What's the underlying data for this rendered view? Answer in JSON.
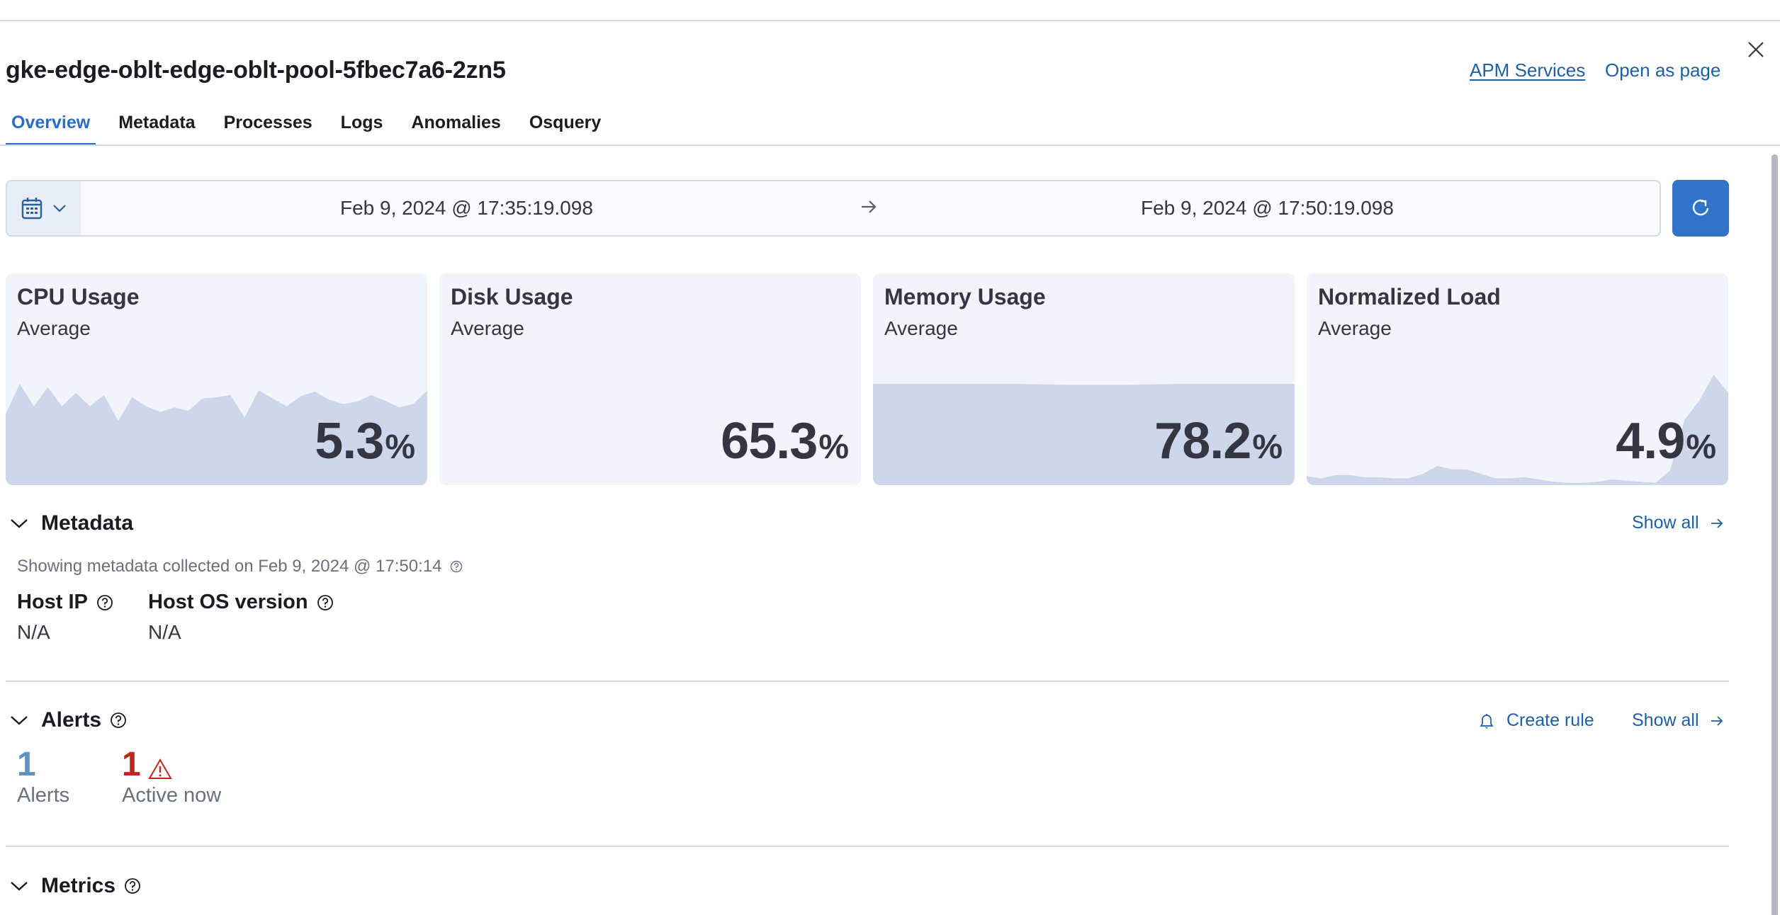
{
  "header": {
    "title": "gke-edge-oblt-edge-oblt-pool-5fbec7a6-2zn5",
    "links": {
      "apm_services": "APM Services",
      "open_as_page": "Open as page"
    },
    "close_icon": "close-icon"
  },
  "tabs": [
    {
      "label": "Overview",
      "active": true
    },
    {
      "label": "Metadata",
      "active": false
    },
    {
      "label": "Processes",
      "active": false
    },
    {
      "label": "Logs",
      "active": false
    },
    {
      "label": "Anomalies",
      "active": false
    },
    {
      "label": "Osquery",
      "active": false
    }
  ],
  "date_picker": {
    "quick_select_icon": "calendar-icon",
    "start": "Feb 9, 2024 @ 17:35:19.098",
    "end": "Feb 9, 2024 @ 17:50:19.098",
    "refresh_icon": "refresh-icon"
  },
  "kpis": [
    {
      "title": "CPU Usage",
      "subtitle": "Average",
      "value": "5.3",
      "unit": "%",
      "trend": [
        0.63,
        0.9,
        0.7,
        0.87,
        0.7,
        0.82,
        0.7,
        0.8,
        0.57,
        0.78,
        0.7,
        0.65,
        0.69,
        0.66,
        0.77,
        0.78,
        0.8,
        0.6,
        0.84,
        0.77,
        0.7,
        0.79,
        0.83,
        0.76,
        0.72,
        0.74,
        0.8,
        0.75,
        0.69,
        0.72,
        0.84
      ],
      "trend_min": 0,
      "trend_max": 1
    },
    {
      "title": "Disk Usage",
      "subtitle": "Average",
      "value": "65.3",
      "unit": "%",
      "trend": [],
      "trend_min": 0,
      "trend_max": 1
    },
    {
      "title": "Memory Usage",
      "subtitle": "Average",
      "value": "78.2",
      "unit": "%",
      "trend": [
        0.9,
        0.9,
        0.9,
        0.9,
        0.9,
        0.9,
        0.895,
        0.89,
        0.89,
        0.89,
        0.895,
        0.9,
        0.9,
        0.9,
        0.9,
        0.9
      ],
      "trend_min": 0,
      "trend_max": 1
    },
    {
      "title": "Normalized Load",
      "subtitle": "Average",
      "value": "4.9",
      "unit": "%",
      "trend": [
        0.08,
        0.06,
        0.09,
        0.09,
        0.07,
        0.07,
        0.06,
        0.06,
        0.1,
        0.17,
        0.14,
        0.14,
        0.1,
        0.06,
        0.06,
        0.07,
        0.05,
        0.03,
        0.02,
        0.02,
        0.03,
        0.05,
        0.04,
        0.03,
        0.02,
        0.13,
        0.58,
        0.75,
        0.98,
        0.82
      ],
      "trend_min": 0,
      "trend_max": 1
    }
  ],
  "metadata": {
    "title": "Metadata",
    "show_all": "Show all",
    "collected_text": "Showing metadata collected on Feb 9, 2024 @ 17:50:14",
    "fields": [
      {
        "label": "Host IP",
        "value": "N/A"
      },
      {
        "label": "Host OS version",
        "value": "N/A"
      }
    ]
  },
  "alerts": {
    "title": "Alerts",
    "create_rule": "Create rule",
    "show_all": "Show all",
    "total_count": "1",
    "total_label": "Alerts",
    "active_count": "1",
    "active_label": "Active now",
    "colors": {
      "total": "#6092c0",
      "active": "#bd271e"
    }
  },
  "metrics": {
    "title": "Metrics"
  },
  "colors": {
    "accent": "#2b6cc4",
    "link": "#1f5fa6",
    "card_bg": "#f1f4fa",
    "spark_fill": "#cdd6ea"
  }
}
